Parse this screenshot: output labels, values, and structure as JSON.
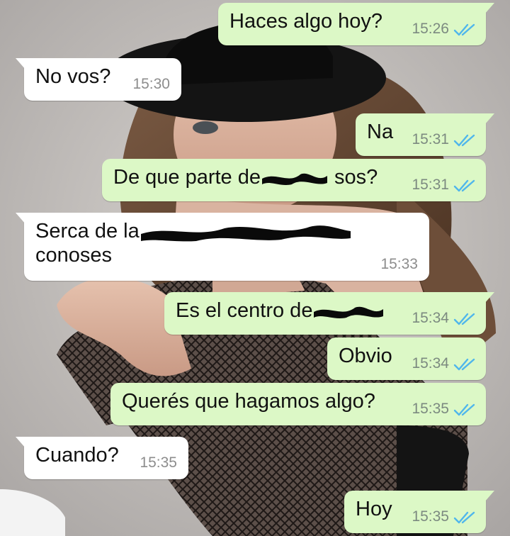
{
  "colors": {
    "outgoing_bubble": "#dcf8c6",
    "incoming_bubble": "#ffffff",
    "timestamp": "#7c8a80",
    "read_ticks": "#4fb6ec"
  },
  "icons": {
    "read_receipt": "double-check-icon"
  },
  "messages": [
    {
      "direction": "outgoing",
      "text": "Haces algo hoy?",
      "time": "15:26",
      "status": "read"
    },
    {
      "direction": "incoming",
      "text": "No vos?",
      "time": "15:30"
    },
    {
      "direction": "outgoing",
      "text": "Na",
      "time": "15:31",
      "status": "read"
    },
    {
      "direction": "outgoing",
      "text_before": "De que parte de",
      "text_after": "sos?",
      "redacted": true,
      "time": "15:31",
      "status": "read"
    },
    {
      "direction": "incoming",
      "line1": "Serca de la",
      "line2": "conoses",
      "redacted": true,
      "time": "15:33"
    },
    {
      "direction": "outgoing",
      "text": "Es el centro de",
      "redacted": true,
      "time": "15:34",
      "status": "read"
    },
    {
      "direction": "outgoing",
      "text": "Obvio",
      "time": "15:34",
      "status": "read"
    },
    {
      "direction": "outgoing",
      "text": "Querés que hagamos algo?",
      "time": "15:35",
      "status": "read"
    },
    {
      "direction": "incoming",
      "text": "Cuando?",
      "time": "15:35"
    },
    {
      "direction": "outgoing",
      "text": "Hoy",
      "time": "15:35",
      "status": "read"
    }
  ]
}
